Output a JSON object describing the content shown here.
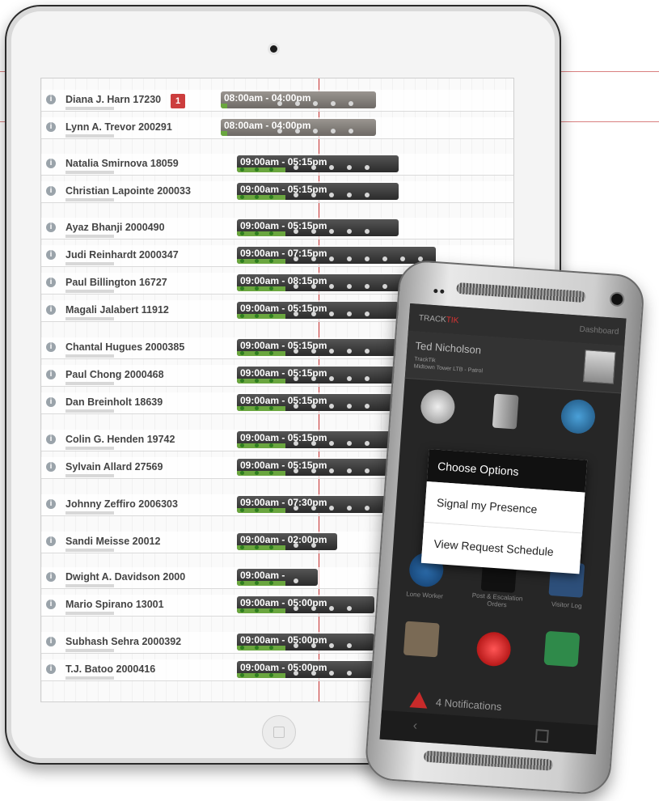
{
  "schedule": {
    "rows": [
      {
        "name": "Diana J. Harn 17230",
        "shift": "08:00am - 04:00pm",
        "badge": "1"
      },
      {
        "name": "Lynn A. Trevor 200291",
        "shift": "08:00am - 04:00pm"
      },
      {
        "name": "Natalia Smirnova 18059",
        "shift": "09:00am - 05:15pm"
      },
      {
        "name": "Christian Lapointe 200033",
        "shift": "09:00am - 05:15pm"
      },
      {
        "name": "Ayaz Bhanji 2000490",
        "shift": "09:00am - 05:15pm"
      },
      {
        "name": "Judi Reinhardt 2000347",
        "shift": "09:00am - 07:15pm"
      },
      {
        "name": "Paul Billington 16727",
        "shift": "09:00am - 08:15pm"
      },
      {
        "name": "Magali Jalabert 11912",
        "shift": "09:00am - 05:15pm"
      },
      {
        "name": "Chantal Hugues 2000385",
        "shift": "09:00am - 05:15pm"
      },
      {
        "name": "Paul Chong 2000468",
        "shift": "09:00am - 05:15pm"
      },
      {
        "name": "Dan Breinholt 18639",
        "shift": "09:00am - 05:15pm"
      },
      {
        "name": "Colin G. Henden 19742",
        "shift": "09:00am - 05:15pm"
      },
      {
        "name": "Sylvain Allard 27569",
        "shift": "09:00am - 05:15pm"
      },
      {
        "name": "Johnny Zeffiro 2006303",
        "shift": "09:00am - 07:30pm"
      },
      {
        "name": "Sandi Meisse 20012",
        "shift": "09:00am - 02:00pm"
      },
      {
        "name": "Dwight A. Davidson 2000",
        "shift": "09:00am -"
      },
      {
        "name": "Mario Spirano 13001",
        "shift": "09:00am - 05:00pm"
      },
      {
        "name": "Subhash Sehra 2000392",
        "shift": "09:00am - 05:00pm"
      },
      {
        "name": "T.J. Batoo 2000416",
        "shift": "09:00am - 05:00pm"
      }
    ]
  },
  "phone": {
    "logo_prefix": "TRACK",
    "logo_suffix": "TIK",
    "dashboard_link": "Dashboard",
    "user_name": "Ted Nicholson",
    "user_org": "TrackTik",
    "user_site": "Midtown Tower LTB - Patrol",
    "dialog": {
      "title": "Choose Options",
      "options": [
        "Signal my Presence",
        "View Request Schedule"
      ]
    },
    "tiles": [
      "Lone Worker",
      "Post & Escalation Orders",
      "Visitor Log"
    ],
    "notifications": "4 Notifications"
  }
}
